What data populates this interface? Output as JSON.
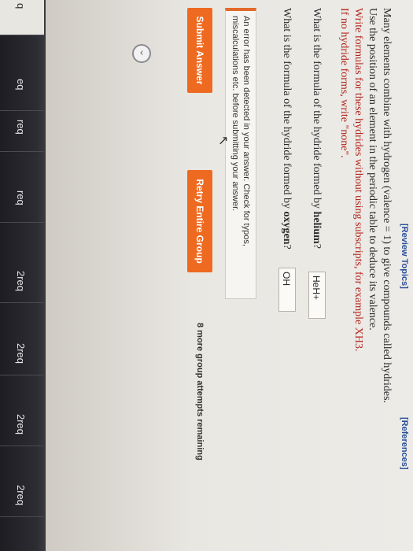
{
  "links": {
    "review_topics": "[Review Topics]",
    "references": "[References]"
  },
  "sidebar": {
    "items": [
      {
        "label": "q"
      },
      {
        "label": "eq"
      },
      {
        "label": "req"
      },
      {
        "label": "req"
      },
      {
        "label": "2req"
      },
      {
        "label": "2req"
      },
      {
        "label": "2req"
      },
      {
        "label": "2req"
      }
    ],
    "collapse_icon": "chevron-left-icon"
  },
  "intro": {
    "line1": "Many elements combine with hydrogen (valence = 1) to give compounds called hydrides.",
    "line2": "Use the position of an element in the periodic table to deduce its valence.",
    "line3": "Write formulas for these hydrides without using subscripts, for example XH3.",
    "line4": "If no hydride forms, write \"none\"."
  },
  "questions": [
    {
      "prompt_prefix": "What is the formula of the hydride formed by ",
      "element": "helium",
      "prompt_suffix": "?",
      "answer": "HeH+"
    },
    {
      "prompt_prefix": "What is the formula of the hydride formed by ",
      "element": "oxygen",
      "prompt_suffix": "?",
      "answer": "OH"
    }
  ],
  "error_message": "An error has been detected in your answer. Check for typos, miscalculations etc. before submitting your answer.",
  "buttons": {
    "submit": "Submit Answer",
    "retry": "Retry Entire Group"
  },
  "attempts_text": "8 more group attempts remaining",
  "colors": {
    "accent_button": "#ee6a21",
    "error_border": "#e26b2b",
    "emphasis_text": "#b3261e",
    "sidebar_bg": "#2c2c33"
  }
}
